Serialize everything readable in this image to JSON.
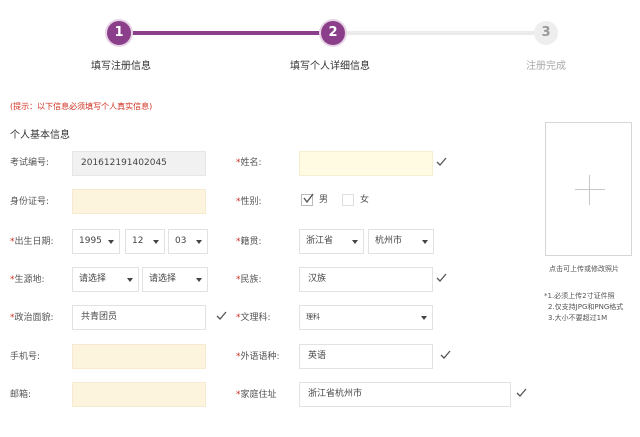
{
  "steps": [
    {
      "number": "1",
      "label": "填写注册信息"
    },
    {
      "number": "2",
      "label": "填写个人详细信息"
    },
    {
      "number": "3",
      "label": "注册完成"
    }
  ],
  "hint": "(提示：以下信息必须填写个人真实信息)",
  "section_title": "个人基本信息",
  "form": {
    "exam_id": {
      "label": "考试编号:",
      "value": "201612191402045"
    },
    "name": {
      "label": "姓名:",
      "value": ""
    },
    "id_card": {
      "label": "身份证号:",
      "value": ""
    },
    "gender": {
      "label": "性别:",
      "options": [
        "男",
        "女"
      ],
      "selected": "男"
    },
    "birth": {
      "label": "出生日期:",
      "year": "1995",
      "month": "12",
      "day": "03"
    },
    "native_place": {
      "label": "籍贯:",
      "province": "浙江省",
      "city": "杭州市"
    },
    "origin": {
      "label": "生源地:",
      "province": "请选择",
      "city": "请选择"
    },
    "ethnicity": {
      "label": "民族:",
      "value": "汉族"
    },
    "political": {
      "label": "政治面貌:",
      "value": "共青团员"
    },
    "track": {
      "label": "文理科:",
      "value": "理科"
    },
    "phone": {
      "label": "手机号:",
      "value": ""
    },
    "language": {
      "label": "外语语种:",
      "value": "英语"
    },
    "email": {
      "label": "邮箱:",
      "value": ""
    },
    "address": {
      "label": "家庭住址",
      "value": "浙江省杭州市"
    }
  },
  "required_mark": "*",
  "photo": {
    "caption": "点击可上传或修改照片",
    "notes": [
      "*1.必须上传2寸证件照",
      "2.仅支持JPG和PNG格式",
      "3.大小不要超过1M"
    ]
  },
  "colors": {
    "accent": "#8b3f8a",
    "required": "#d0301f",
    "field_yellow": "#fdf4dd"
  }
}
